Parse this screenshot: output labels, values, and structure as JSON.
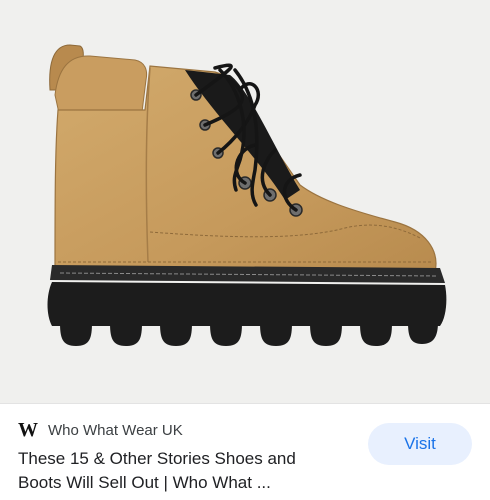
{
  "result_card": {
    "image_subject": "tan suede lace-up hiking boot with black lugged platform sole",
    "source": {
      "logo_icon": "who-what-wear-w-logo",
      "logo_text": "W",
      "site_name": "Who What Wear UK"
    },
    "title_line_1": "These 15 & Other Stories Shoes and",
    "title_line_2": "Boots Will Sell Out | Who What ...",
    "visit_label": "Visit"
  },
  "colors": {
    "background": "#f0f0ee",
    "boot_leather": "#c9a062",
    "sole": "#1c1c1c",
    "visit_button_bg": "#e8f0fe",
    "visit_button_text": "#1a73e8"
  }
}
